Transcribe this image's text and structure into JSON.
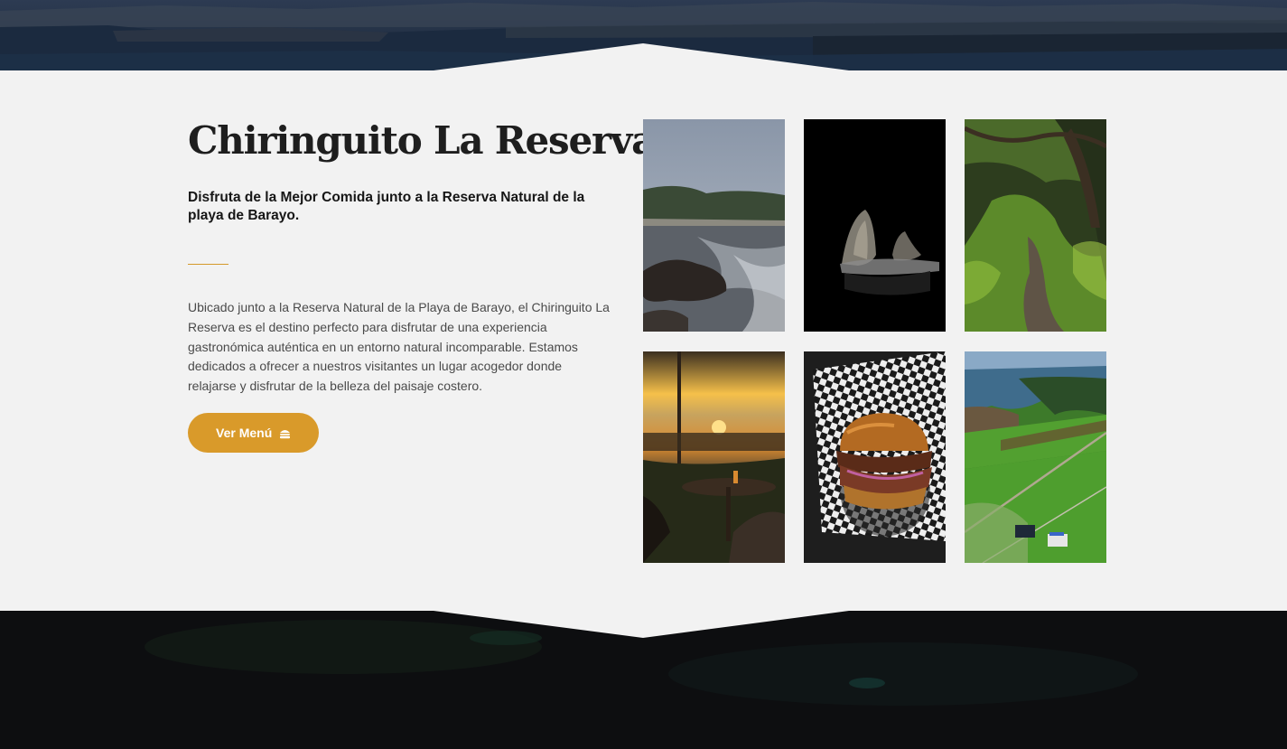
{
  "intro": {
    "title": "Chiringuito La Reserva",
    "subtitle": "Disfruta de la Mejor Comida junto a la Reserva Natural de la playa de Barayo.",
    "body": "Ubicado junto a la Reserva Natural de la Playa de Barayo, el Chiringuito La Reserva es el destino perfecto para disfrutar de una experiencia gastronómica auténtica en un entorno natural incomparable. Estamos dedicados a ofrecer a nuestros visitantes un lugar acogedor donde relajarse y disfrutar de la belleza del paisaje costero.",
    "button_label": "Ver Menú",
    "button_icon": "burger-icon"
  },
  "gallery": {
    "images": [
      {
        "name": "beach-rocks-photo"
      },
      {
        "name": "dark-cave-photo"
      },
      {
        "name": "forest-path-photo"
      },
      {
        "name": "sunset-terrace-photo"
      },
      {
        "name": "pulled-pork-burger-photo"
      },
      {
        "name": "aerial-coast-fields-photo"
      }
    ]
  },
  "colors": {
    "accent": "#d99a2a",
    "background": "#f2f2f2",
    "heading": "#1e1e1e",
    "text": "#4a4a4a",
    "dark_section": "#0d0e10"
  }
}
